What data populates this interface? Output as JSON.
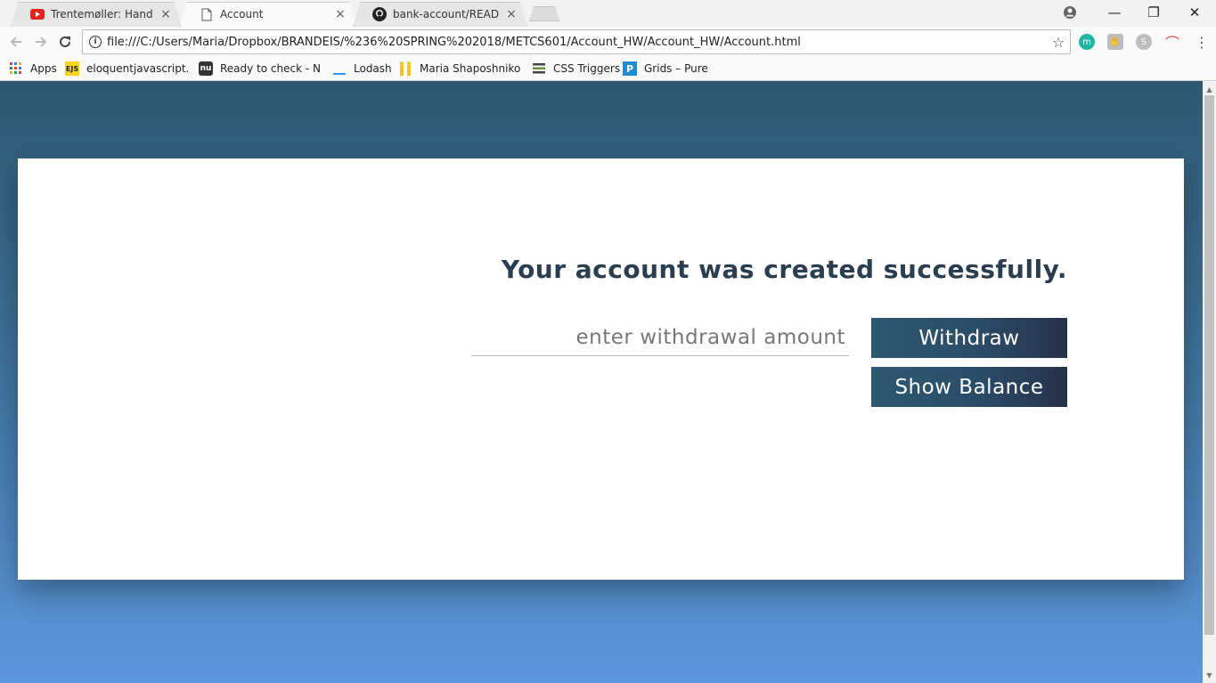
{
  "browser": {
    "tabs": [
      {
        "title": "Trentemøller: Hands Dow",
        "icon": "youtube-icon",
        "active": false
      },
      {
        "title": "Account",
        "icon": "page-icon",
        "active": true
      },
      {
        "title": "bank-account/README.m",
        "icon": "github-icon",
        "active": false
      }
    ],
    "tab_close": "×",
    "window": {
      "minimize": "—",
      "maximize": "❐",
      "close": "✕"
    },
    "address": "file:///C:/Users/Maria/Dropbox/BRANDEIS/%236%20SPRING%202018/METCS601/Account_HW/Account_HW/Account.html",
    "bookmarks": [
      {
        "label": "Apps",
        "icon": "apps-grid-icon"
      },
      {
        "label": "eloquentjavascript.ne",
        "icon": "ejs-icon",
        "icon_text": "EJS"
      },
      {
        "label": "Ready to check - Nu l",
        "icon": "nu-icon",
        "icon_text": "nu"
      },
      {
        "label": "Lodash",
        "icon": "lodash-icon"
      },
      {
        "label": "Maria Shaposhnikova",
        "icon": "bookmark-person-icon"
      },
      {
        "label": "CSS Triggers",
        "icon": "css-triggers-icon"
      },
      {
        "label": "Grids – Pure",
        "icon": "pure-icon",
        "icon_text": "P"
      }
    ],
    "extensions": [
      {
        "icon": "extension-m-icon",
        "text": "m",
        "color": "#1fb5a0"
      },
      {
        "icon": "extension-hand-icon",
        "text": "✋",
        "color": "#9e9e9e"
      },
      {
        "icon": "extension-skype-icon",
        "text": "S",
        "color": "#9e9e9e"
      },
      {
        "icon": "extension-rainbow-icon",
        "text": "⌒",
        "color": "#e04a3c"
      }
    ]
  },
  "page": {
    "headline": "Your account was created successfully.",
    "amount_placeholder": "enter withdrawal amount",
    "withdraw_label": "Withdraw",
    "balance_label": "Show Balance"
  },
  "colors": {
    "background_top": "#2e5870",
    "background_bottom": "#5d98dd",
    "headline": "#2b3e50",
    "button": "#2b4c68"
  }
}
